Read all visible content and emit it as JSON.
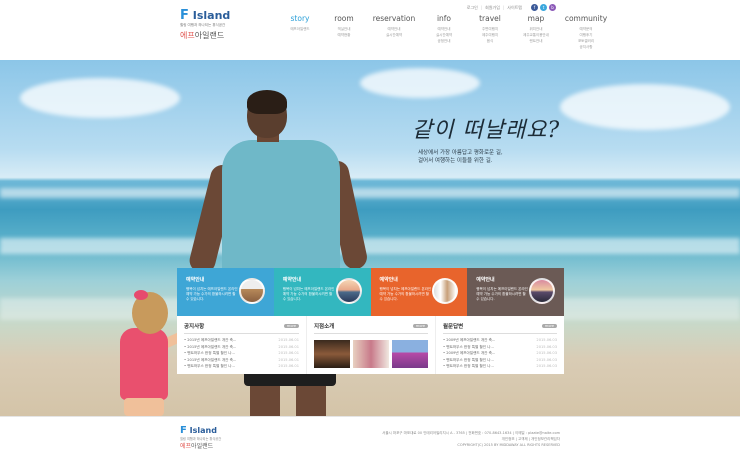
{
  "util": {
    "links": [
      "로그인",
      "회원가입",
      "사이트맵"
    ],
    "sns": [
      "f",
      "t",
      "b"
    ]
  },
  "logo": {
    "letter": "F",
    "word": "Island",
    "tagline": "힐링 여행과 하나되는 휴식공간",
    "name_accent": "에프",
    "name_rest": "아일랜드"
  },
  "nav": [
    {
      "label": "story",
      "subs": [
        "에프아일랜드"
      ]
    },
    {
      "label": "room",
      "subs": [
        "객실안내",
        "예약현황"
      ]
    },
    {
      "label": "reservation",
      "subs": [
        "예약안내",
        "실시간예약"
      ]
    },
    {
      "label": "info",
      "subs": [
        "예약안내",
        "실시간예약",
        "공정안내"
      ]
    },
    {
      "label": "travel",
      "subs": [
        "주변여행지",
        "제주여행지",
        "음식"
      ]
    },
    {
      "label": "map",
      "subs": [
        "위치안내",
        "제주교통이용안내",
        "렌트안내"
      ]
    },
    {
      "label": "community",
      "subs": [
        "예약문의",
        "여행후기",
        "포토갤러리",
        "공지사항"
      ]
    }
  ],
  "hero": {
    "headline": "같이 떠날래요?",
    "sub_line1": "세상에서 가장 아름답고 평화로운 길,",
    "sub_line2": "걸어서 여행하는 이들을 위한 길."
  },
  "cards": [
    {
      "title": "예약안내",
      "desc": "행복이 넘치는 에프아일랜드 온라인 예약 가능 수가의 환불하시려면 할 수 있습니다."
    },
    {
      "title": "예약안내",
      "desc": "행복이 넘치는 에프아일랜드 온라인 예약 가능 수가의 환불하시려면 할 수 있습니다."
    },
    {
      "title": "예약안내",
      "desc": "행복이 넘치는 에프아일랜드 온라인 예약 가능 수가의 환불하시려면 할 수 있습니다."
    },
    {
      "title": "예약안내",
      "desc": "행복이 넘치는 에프아일랜드 온라인 예약 가능 수가의 환불하시려면 할 수 있습니다."
    }
  ],
  "card_colors": [
    "#3ea6d6",
    "#33b7bf",
    "#e8642c",
    "#6b5a55"
  ],
  "notice": {
    "title": "공지사항",
    "more": "more",
    "items": [
      {
        "text": "• 2015년 에프아일랜드 개관 축...",
        "date": "2015.06.01"
      },
      {
        "text": "• 2015년 에프아일랜드 개관 축...",
        "date": "2015.06.01"
      },
      {
        "text": "• 펜트하우스 한정 특별 할인 나...",
        "date": "2015.06.01"
      },
      {
        "text": "• 2015년 에프아일랜드 개관 축...",
        "date": "2015.06.01"
      },
      {
        "text": "• 펜트하우스 한정 특별 할인 나...",
        "date": "2015.06.01"
      }
    ]
  },
  "photos": {
    "title": "지점소개",
    "more": "more"
  },
  "qna": {
    "title": "월문답변",
    "more": "more",
    "items": [
      {
        "text": "• 2009년 에프아일랜드 개관 축...",
        "date": "2015.06.03"
      },
      {
        "text": "• 펜트하우스 한정 특별 할인 나...",
        "date": "2015.06.03"
      },
      {
        "text": "• 2009년 에프아일랜드 개관 축...",
        "date": "2015.06.03"
      },
      {
        "text": "• 펜트하우스 한정 특별 할인 나...",
        "date": "2015.06.03"
      },
      {
        "text": "• 펜트하우스 한정 특별 할인 나...",
        "date": "2015.06.03"
      }
    ]
  },
  "footer": {
    "line1": "서울시 마포구 마포대로 00 인테리어빌리지시 A - 3765  |  전화번호 : 070-8643-1634  |  이메일 : plaate@naite.com",
    "line2": "개인정보  |  고객께  |  개인정보관리책임자",
    "line3": "COPYRIGHT(C) 2015 BY MIDDAWAY  ALL RIGHTS RESERVED"
  }
}
